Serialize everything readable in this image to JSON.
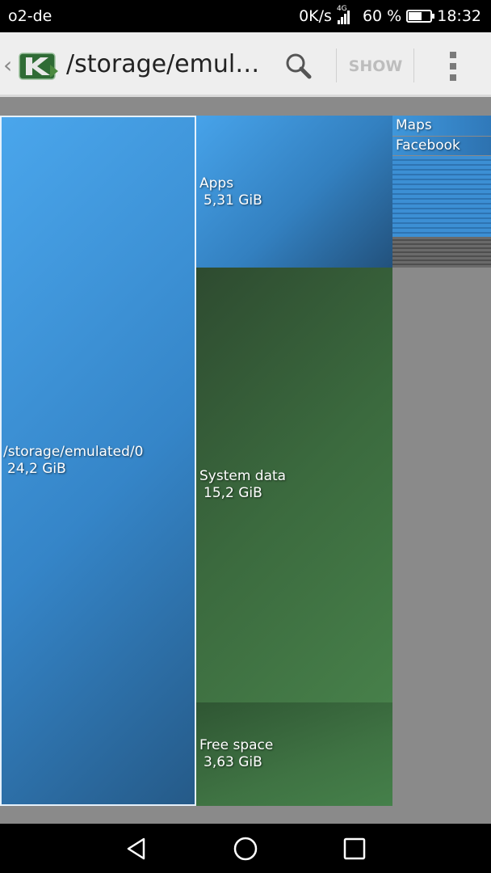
{
  "status_bar": {
    "carrier": "o2-de",
    "net_speed": "0K/s",
    "network_type": "4G",
    "battery_percent": "60 %",
    "battery_level": 0.6,
    "time": "18:32"
  },
  "app_bar": {
    "back_icon": "chevron-left-icon",
    "logo_icon": "app-logo-icon",
    "path_title": "/storage/emul…",
    "search_icon": "search-icon",
    "show_label": "SHOW",
    "overflow_icon": "more-vert-icon"
  },
  "treemap": {
    "root": {
      "name": "/storage/emulated/0",
      "size": "24,2 GiB"
    },
    "children": [
      {
        "name": "Apps",
        "size": "5,31 GiB",
        "color": "#3d8fd8"
      },
      {
        "name": "System data",
        "size": "15,2 GiB",
        "color": "#3d6b40"
      },
      {
        "name": "Free space",
        "size": "3,63 GiB",
        "color": "#3f7443"
      }
    ],
    "app_items": [
      {
        "name": "Maps"
      },
      {
        "name": "Facebook"
      }
    ]
  },
  "nav_bar": {
    "back_icon": "triangle-back-icon",
    "home_icon": "circle-home-icon",
    "recents_icon": "square-recents-icon"
  },
  "colors": {
    "app_bar_bg": "#eeeeee",
    "folder_blue": "#3585c8",
    "system_green": "#3b6a3e",
    "background_gray": "#8a8a8a"
  }
}
